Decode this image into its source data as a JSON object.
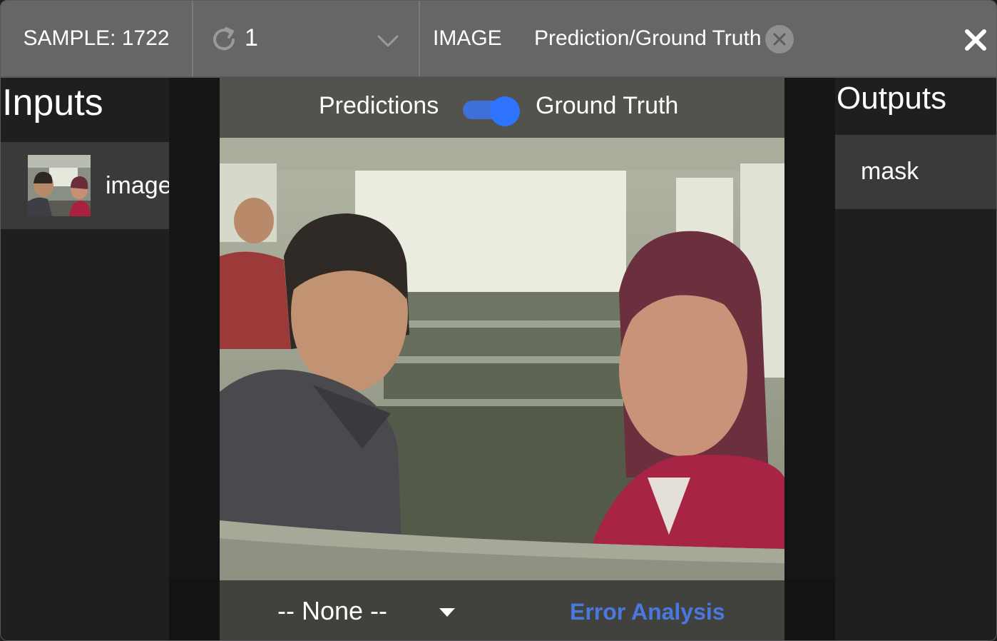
{
  "header": {
    "sample_label": "SAMPLE: 1722",
    "sequence_value": "1",
    "view_label": "IMAGE",
    "view_value": "Prediction/Ground Truth"
  },
  "inputs": {
    "title": "Inputs",
    "items": [
      {
        "label": "image"
      }
    ]
  },
  "viewer": {
    "toggle_left_label": "Predictions",
    "toggle_right_label": "Ground Truth",
    "toggle_on": true,
    "class_select_value": "-- None --",
    "error_analysis_label": "Error Analysis",
    "accent_color": "#2f74ff",
    "link_color": "#4a78e0"
  },
  "outputs": {
    "title": "Outputs",
    "items": [
      {
        "label": "mask"
      }
    ]
  },
  "icons": {
    "refresh": "refresh-icon",
    "dropdown": "chevron-down-icon",
    "clear": "clear-circle-icon",
    "close": "close-icon",
    "caret": "caret-down-icon"
  }
}
